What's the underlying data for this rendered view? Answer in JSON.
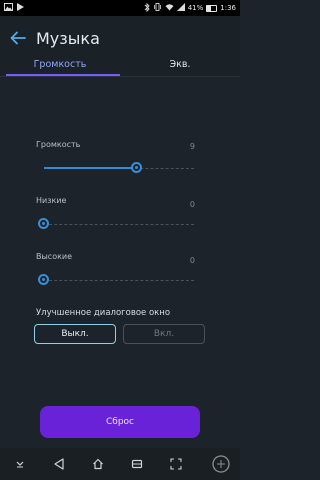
{
  "status_bar": {
    "battery": "41%",
    "time": "1:36"
  },
  "app_bar": {
    "title": "Музыка"
  },
  "tabs": [
    {
      "label": "Громкость",
      "active": true
    },
    {
      "label": "Экв.",
      "active": false
    }
  ],
  "sliders": {
    "volume": {
      "label": "Громкость",
      "value": "9",
      "max": 15
    },
    "low": {
      "label": "Низкие",
      "value": "0"
    },
    "high": {
      "label": "Высокие",
      "value": "0"
    }
  },
  "dialog_enhance": {
    "label": "Улучшенное диалоговое окно",
    "off_label": "Выкл.",
    "on_label": "Вкл.",
    "selected": "off"
  },
  "reset_button": {
    "label": "Сброс"
  },
  "colors": {
    "accent": "#7b5ff5",
    "slider": "#3b8ed8",
    "reset": "#6a22d8",
    "background": "#1c232a"
  }
}
